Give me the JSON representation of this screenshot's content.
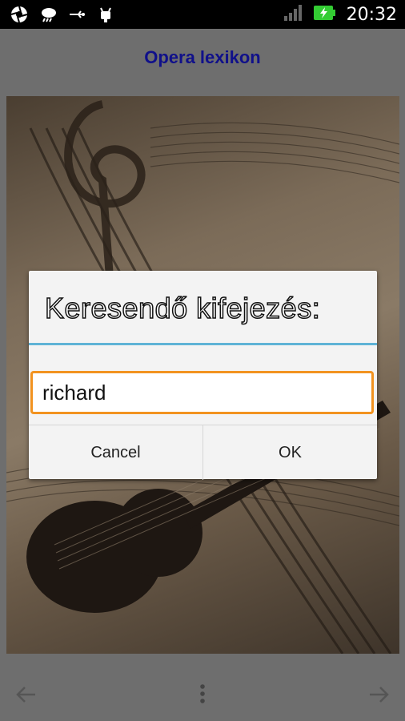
{
  "status_bar": {
    "icons_left": [
      "aperture-icon",
      "weather-icon",
      "usb-icon",
      "android-debug-icon"
    ],
    "signal": "signal-strength-icon",
    "battery": "battery-charging-icon",
    "time": "20:32"
  },
  "app": {
    "title": "Opera lexikon"
  },
  "background_image": "music-notes-violin-sepia",
  "dialog": {
    "title": "Keresendő kifejezés:",
    "input_value": "richard",
    "cancel_label": "Cancel",
    "ok_label": "OK"
  },
  "bottom_nav": {
    "back": "arrow-left-icon",
    "menu": "overflow-menu-icon",
    "forward": "arrow-right-icon"
  },
  "colors": {
    "title": "#10108a",
    "divider": "#5fb3d6",
    "input_border": "#f29320"
  }
}
